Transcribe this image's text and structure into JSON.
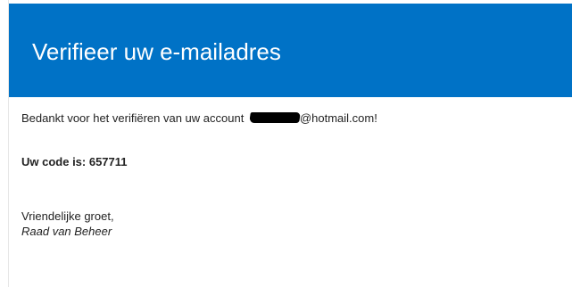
{
  "header": {
    "title": "Verifieer uw e-mailadres"
  },
  "message": {
    "thanks_prefix": "Bedankt voor het verifiëren van uw account",
    "thanks_suffix": "@hotmail.com!",
    "code_line": "Uw code is: 657711",
    "greeting": "Vriendelijke groet,",
    "signature": "Raad van Beheer"
  },
  "colors": {
    "banner_background": "#0072c6",
    "banner_text": "#ffffff",
    "body_text": "#222222"
  }
}
